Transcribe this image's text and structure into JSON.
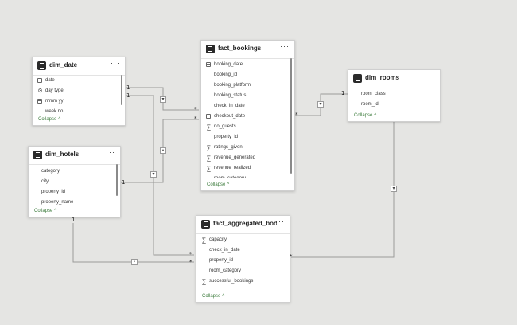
{
  "tables": {
    "dim_date": {
      "name": "dim_date",
      "fields": [
        {
          "label": "date",
          "icon": "calendar-icon"
        },
        {
          "label": "day type",
          "icon": "computed-icon"
        },
        {
          "label": "mmm yy",
          "icon": "calendar-icon"
        },
        {
          "label": "week no",
          "icon": ""
        }
      ],
      "collapse": "Collapse"
    },
    "dim_hotels": {
      "name": "dim_hotels",
      "fields": [
        {
          "label": "category",
          "icon": ""
        },
        {
          "label": "city",
          "icon": ""
        },
        {
          "label": "property_id",
          "icon": ""
        },
        {
          "label": "property_name",
          "icon": ""
        }
      ],
      "collapse": "Collapse"
    },
    "fact_bookings": {
      "name": "fact_bookings",
      "fields": [
        {
          "label": "booking_date",
          "icon": "calendar-icon"
        },
        {
          "label": "booking_id",
          "icon": ""
        },
        {
          "label": "booking_platform",
          "icon": ""
        },
        {
          "label": "booking_status",
          "icon": ""
        },
        {
          "label": "check_in_date",
          "icon": ""
        },
        {
          "label": "checkout_date",
          "icon": "calendar-icon"
        },
        {
          "label": "no_guests",
          "icon": "sigma-icon"
        },
        {
          "label": "property_id",
          "icon": ""
        },
        {
          "label": "ratings_given",
          "icon": "sigma-icon"
        },
        {
          "label": "revenue_generated",
          "icon": "sigma-icon"
        },
        {
          "label": "revenue_realized",
          "icon": "sigma-icon"
        },
        {
          "label": "room_category",
          "icon": ""
        }
      ],
      "collapse": "Collapse"
    },
    "dim_rooms": {
      "name": "dim_rooms",
      "fields": [
        {
          "label": "room_class",
          "icon": ""
        },
        {
          "label": "room_id",
          "icon": ""
        }
      ],
      "collapse": "Collapse"
    },
    "fact_aggregated_bookings": {
      "name": "fact_aggregated_booki...",
      "fields": [
        {
          "label": "capacity",
          "icon": "sigma-icon"
        },
        {
          "label": "check_in_date",
          "icon": ""
        },
        {
          "label": "property_id",
          "icon": ""
        },
        {
          "label": "room_category",
          "icon": ""
        },
        {
          "label": "successful_bookings",
          "icon": "sigma-icon"
        }
      ],
      "collapse": "Collapse"
    }
  },
  "more_label": "···",
  "cardinality": {
    "one": "1",
    "many": "*"
  },
  "colors": {
    "canvas": "#e5e5e3",
    "line": "#9a9a9a",
    "collapse": "#3a7a3a"
  }
}
